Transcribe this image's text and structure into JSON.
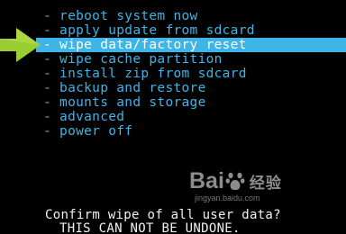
{
  "recovery_menu": {
    "items": [
      {
        "label": "- reboot system now",
        "selected": false
      },
      {
        "label": "- apply update from sdcard",
        "selected": false
      },
      {
        "label": "- wipe data/factory reset",
        "selected": true
      },
      {
        "label": "- wipe cache partition",
        "selected": false
      },
      {
        "label": "- install zip from sdcard",
        "selected": false
      },
      {
        "label": "- backup and restore",
        "selected": false
      },
      {
        "label": "- mounts and storage",
        "selected": false
      },
      {
        "label": "- advanced",
        "selected": false
      },
      {
        "label": "- power off",
        "selected": false
      }
    ]
  },
  "confirm": {
    "line1": "Confirm wipe of all user data?",
    "line2": "THIS CAN NOT BE UNDONE."
  },
  "watermark": {
    "logo_left": "Bai",
    "logo_right": "经验",
    "url": "jingyan.baidu.com"
  },
  "colors": {
    "background": "#000000",
    "menu_text": "#3fb4e6",
    "highlight": "#3fb4e6",
    "highlight_text": "#ffffff",
    "arrow": "#9acd32",
    "confirm_text": "#f2f2f2"
  },
  "icons": {
    "pointer": "green-arrow-icon",
    "paw": "baidu-paw-icon"
  }
}
